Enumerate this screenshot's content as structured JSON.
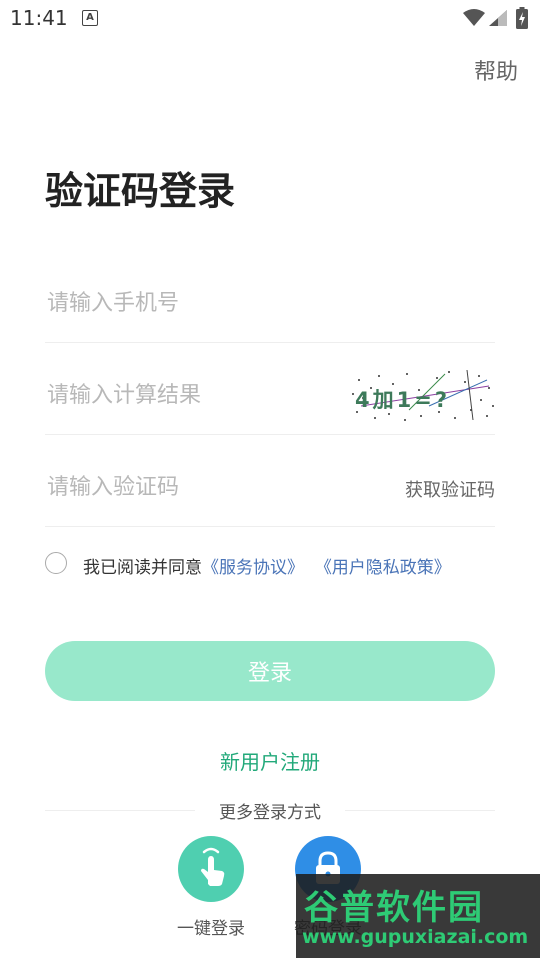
{
  "status_bar": {
    "time": "11:41",
    "notification_icon": "text-a-icon",
    "wifi_icon": "wifi-icon",
    "signal_icon": "signal-icon",
    "battery_icon": "battery-charging-icon"
  },
  "header": {
    "help_label": "帮助"
  },
  "title": "验证码登录",
  "form": {
    "phone_placeholder": "请输入手机号",
    "calc_placeholder": "请输入计算结果",
    "captcha_text": "4加1=?",
    "code_placeholder": "请输入验证码",
    "get_code_label": "获取验证码"
  },
  "agreement": {
    "prefix": "我已阅读并同意",
    "service_link": "《服务协议》",
    "privacy_link": "《用户隐私政策》"
  },
  "login_button_label": "登录",
  "register_label": "新用户注册",
  "more_login_label": "更多登录方式",
  "alt_logins": [
    {
      "label": "一键登录",
      "icon": "touch-hand-icon"
    },
    {
      "label": "密码登录",
      "icon": "lock-icon"
    }
  ],
  "watermark": {
    "logo": "谷普软件园",
    "url": "www.gupuxiazai.com"
  },
  "colors": {
    "accent": "#22a97a",
    "login_button": "#98e8cb",
    "link": "#4a74b7",
    "onekey": "#4fcfb0",
    "password": "#2f8ee6"
  }
}
